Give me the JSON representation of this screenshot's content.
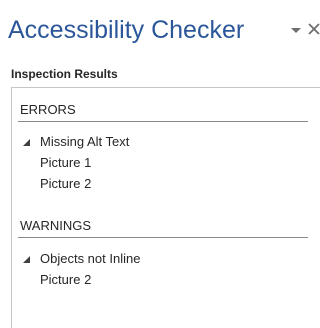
{
  "pane": {
    "title": "Accessibility Checker",
    "options_icon": "dropdown-arrow-icon",
    "close_icon": "close-icon"
  },
  "inspection": {
    "label": "Inspection Results",
    "groups": [
      {
        "header": "ERRORS",
        "issues": [
          {
            "label": "Missing Alt Text",
            "expanded": true,
            "items": [
              "Picture 1",
              "Picture 2"
            ]
          }
        ]
      },
      {
        "header": "WARNINGS",
        "issues": [
          {
            "label": "Objects not Inline",
            "expanded": true,
            "items": [
              "Picture 2"
            ]
          }
        ]
      }
    ]
  },
  "colors": {
    "title": "#2b579a",
    "text": "#262626",
    "border": "#c6c6c6",
    "divider": "#8a8a8a"
  }
}
